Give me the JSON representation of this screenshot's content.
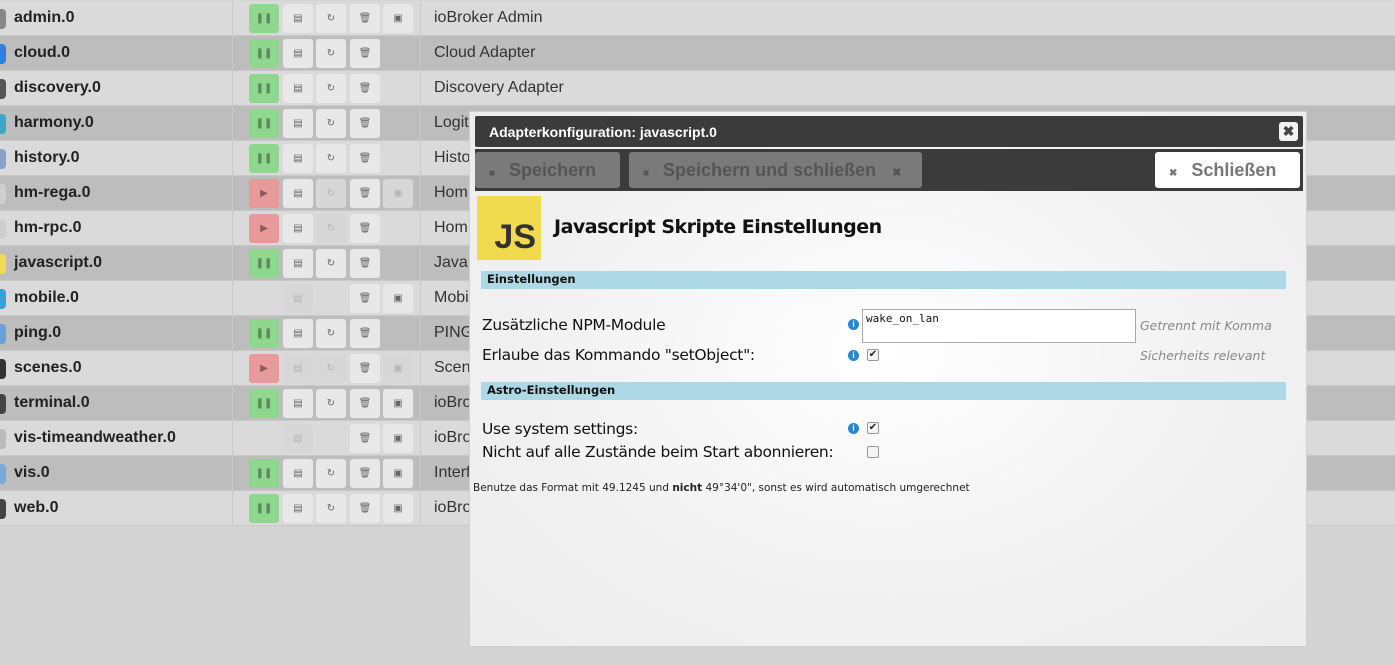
{
  "adapters": [
    {
      "name": "admin.0",
      "desc": "ioBroker Admin",
      "color": "#888",
      "btns": [
        "pause",
        "log",
        "restart",
        "delete",
        "web"
      ]
    },
    {
      "name": "cloud.0",
      "desc": "Cloud Adapter",
      "color": "#2f7fe0",
      "btns": [
        "pause",
        "log",
        "restart",
        "delete",
        ""
      ]
    },
    {
      "name": "discovery.0",
      "desc": "Discovery Adapter",
      "color": "#555",
      "btns": [
        "pause",
        "log",
        "restart",
        "delete",
        ""
      ]
    },
    {
      "name": "harmony.0",
      "desc": "Logit",
      "color": "#3aa7c4",
      "btns": [
        "pause",
        "log",
        "restart",
        "delete",
        ""
      ]
    },
    {
      "name": "history.0",
      "desc": "Histo",
      "color": "#8aa0c8",
      "btns": [
        "pause",
        "log",
        "restart",
        "delete",
        ""
      ]
    },
    {
      "name": "hm-rega.0",
      "desc": "Hom",
      "color": "#cfcfcf",
      "btns": [
        "play",
        "log",
        "restart-dis",
        "delete",
        "web-dis"
      ]
    },
    {
      "name": "hm-rpc.0",
      "desc": "Hom",
      "color": "#cfcfcf",
      "btns": [
        "play",
        "log",
        "restart-dis",
        "delete",
        ""
      ]
    },
    {
      "name": "javascript.0",
      "desc": "Java",
      "color": "#f0db4f",
      "btns": [
        "pause",
        "log",
        "restart",
        "delete",
        ""
      ]
    },
    {
      "name": "mobile.0",
      "desc": "Mobi",
      "color": "#3aa0d8",
      "btns": [
        "",
        "log-dis",
        "",
        "delete",
        "web"
      ]
    },
    {
      "name": "ping.0",
      "desc": "PING",
      "color": "#6a9fd8",
      "btns": [
        "pause",
        "log",
        "restart",
        "delete",
        ""
      ]
    },
    {
      "name": "scenes.0",
      "desc": "Scen",
      "color": "#333",
      "btns": [
        "play",
        "log-dis",
        "restart-dis",
        "delete",
        "web-dis"
      ]
    },
    {
      "name": "terminal.0",
      "desc": "ioBro",
      "color": "#444",
      "btns": [
        "pause",
        "log",
        "restart",
        "delete",
        "web"
      ]
    },
    {
      "name": "vis-timeandweather.0",
      "desc": "ioBro",
      "color": "#bbb",
      "btns": [
        "",
        "log-dis",
        "",
        "delete",
        "web"
      ]
    },
    {
      "name": "vis.0",
      "desc": "Interf",
      "color": "#7aa8d8",
      "btns": [
        "pause",
        "log",
        "restart",
        "delete",
        "web"
      ]
    },
    {
      "name": "web.0",
      "desc": "ioBro",
      "color": "#444",
      "btns": [
        "pause",
        "log",
        "restart",
        "delete",
        "web"
      ]
    }
  ],
  "icons": {
    "pause": "❚❚",
    "play": "▶",
    "log": "▤",
    "restart": "↻",
    "delete": "🗑",
    "web": "▣"
  },
  "dialog": {
    "title": "Adapterkonfiguration: javascript.0",
    "close_x": "✖",
    "save": "Speichern",
    "save_close": "Speichern und schließen",
    "close": "Schließen",
    "logo": "JS",
    "heading": "Javascript Skripte Einstellungen",
    "section1": "Einstellungen",
    "npm_label": "Zusätzliche NPM-Module",
    "npm_value": "wake_on_lan",
    "npm_hint": "Getrennt mit Komma",
    "setobject_label": "Erlaube das Kommando \"setObject\":",
    "setobject_checked": true,
    "setobject_hint": "Sicherheits relevant",
    "section2": "Astro-Einstellungen",
    "system_label": "Use system settings:",
    "system_checked": true,
    "subscribe_label": "Nicht auf alle Zustände beim Start abonnieren:",
    "subscribe_checked": false,
    "note_a": "Benutze das Format mit 49.1245 und ",
    "note_b": "nicht",
    "note_c": " 49°34'0\", sonst es wird automatisch umgerechnet"
  }
}
